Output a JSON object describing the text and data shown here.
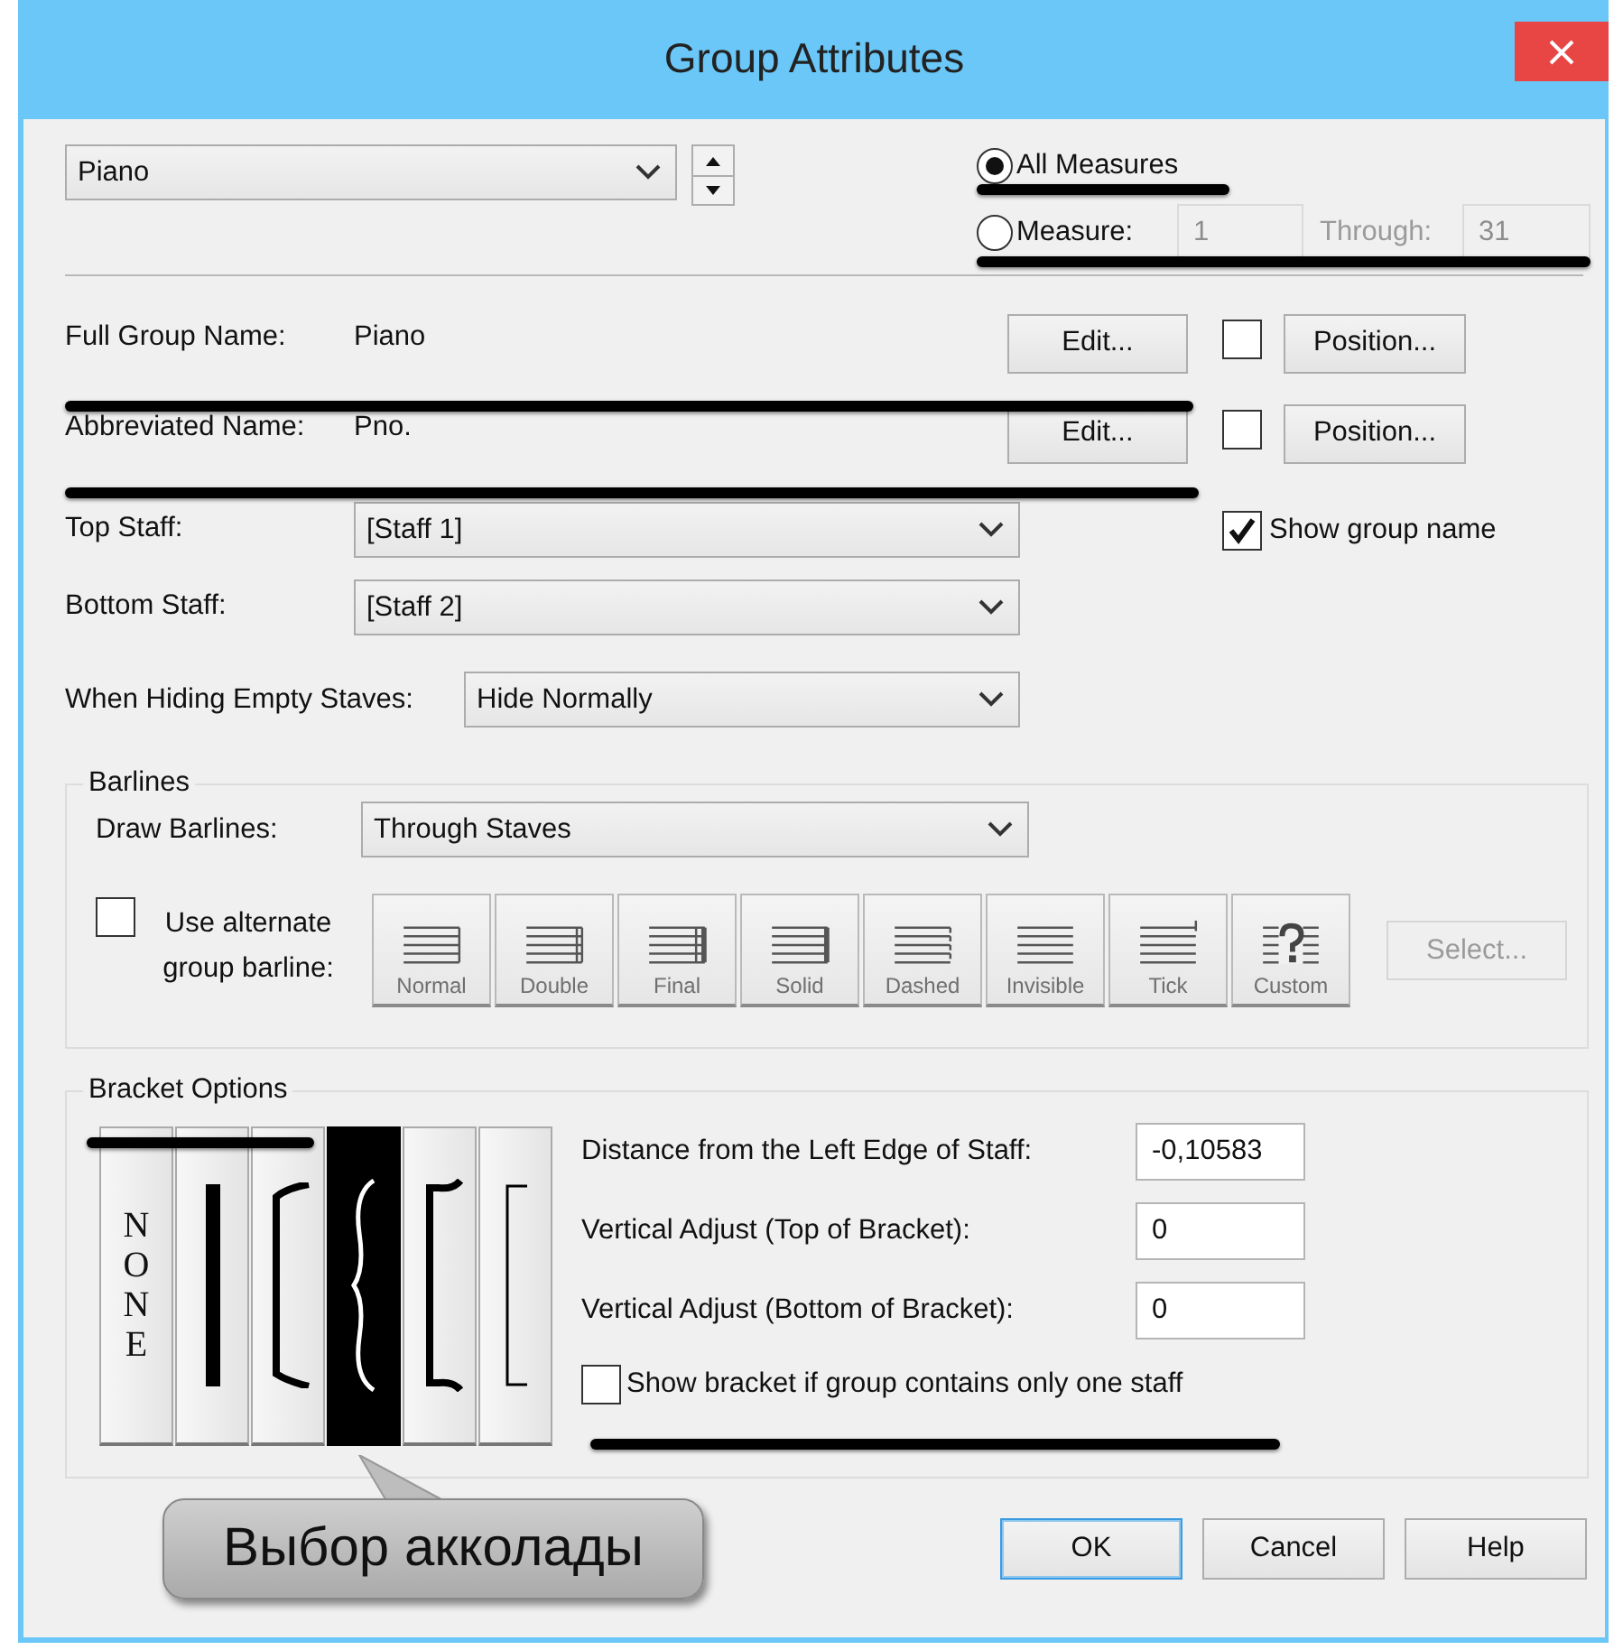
{
  "window": {
    "title": "Group Attributes"
  },
  "group_select": {
    "value": "Piano"
  },
  "range": [
    {
      "label": "All Measures",
      "selected": true
    },
    {
      "label": "Measure:",
      "selected": false
    }
  ],
  "measure_from": "1",
  "through_label": "Through:",
  "measure_to": "31",
  "names": [
    {
      "label": "Full Group Name:",
      "value": "Piano",
      "edit": "Edit...",
      "checked": false,
      "position": "Position..."
    },
    {
      "label": "Abbreviated Name:",
      "value": "Pno.",
      "edit": "Edit...",
      "checked": false,
      "position": "Position..."
    }
  ],
  "top_staff": {
    "label": "Top Staff:",
    "value": "[Staff 1]"
  },
  "show_group_name": {
    "label": "Show group name",
    "checked": true
  },
  "bottom_staff": {
    "label": "Bottom Staff:",
    "value": "[Staff 2]"
  },
  "hiding": {
    "label": "When Hiding Empty Staves:",
    "value": "Hide Normally"
  },
  "barlines": {
    "title": "Barlines",
    "draw_label": "Draw Barlines:",
    "draw_value": "Through Staves",
    "alternate": {
      "label": "Use alternate group barline:",
      "checked": false
    },
    "styles": [
      {
        "kind": "normal",
        "label": "Normal"
      },
      {
        "kind": "double",
        "label": "Double"
      },
      {
        "kind": "final",
        "label": "Final"
      },
      {
        "kind": "solid",
        "label": "Solid"
      },
      {
        "kind": "dashed",
        "label": "Dashed"
      },
      {
        "kind": "invisible",
        "label": "Invisible"
      },
      {
        "kind": "tick",
        "label": "Tick"
      },
      {
        "kind": "custom",
        "label": "Custom"
      }
    ],
    "select_button": "Select..."
  },
  "brackets": {
    "title": "Bracket Options",
    "styles": [
      {
        "kind": "none",
        "label": "NONE",
        "selected": false
      },
      {
        "kind": "bar",
        "selected": false
      },
      {
        "kind": "curved",
        "selected": false
      },
      {
        "kind": "brace",
        "selected": true
      },
      {
        "kind": "hooked",
        "selected": false
      },
      {
        "kind": "thin",
        "selected": false
      }
    ],
    "fields": [
      {
        "label": "Distance from the Left Edge of Staff:",
        "value": "-0,10583"
      },
      {
        "label": "Vertical Adjust (Top of Bracket):",
        "value": "0"
      },
      {
        "label": "Vertical Adjust (Bottom of Bracket):",
        "value": "0"
      }
    ],
    "single_staff": {
      "label": "Show bracket if group contains only one staff",
      "checked": false
    }
  },
  "callout": {
    "text": "Выбор акколады"
  },
  "buttons": [
    {
      "label": "OK",
      "default": true
    },
    {
      "label": "Cancel",
      "default": false
    },
    {
      "label": "Help",
      "default": false
    }
  ]
}
